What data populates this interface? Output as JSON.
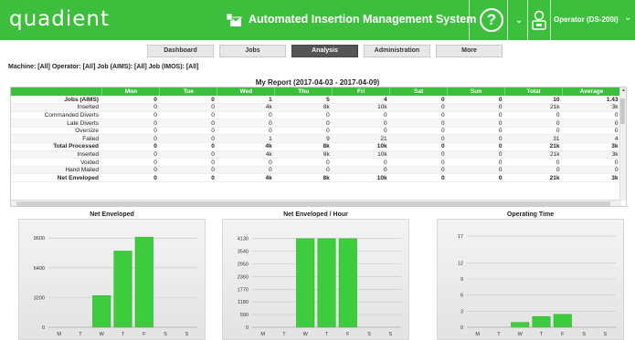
{
  "header": {
    "logo": "quadient",
    "title": "Automated Insertion Management System",
    "help": "?",
    "user": "Operator (DS-200i)"
  },
  "nav": [
    "Dashboard",
    "Jobs",
    "Analysis",
    "Administration",
    "More"
  ],
  "nav_active": "Analysis",
  "filters": "Machine: [All]   Operator: [All]   Job (AIMS): [All]   Job (IMOS): [All]",
  "report_title": "My Report (2017-04-03 - 2017-04-09)",
  "table": {
    "columns": [
      "",
      "Mon",
      "Tue",
      "Wed",
      "Thu",
      "Fri",
      "Sat",
      "Sun",
      "Total",
      "Average"
    ],
    "rows": [
      {
        "label": "Jobs (AIMS)",
        "bold": true,
        "cells": [
          "0",
          "0",
          "1",
          "5",
          "4",
          "0",
          "0",
          "10",
          "1.43"
        ]
      },
      {
        "label": "Inserted",
        "bold": false,
        "cells": [
          "0",
          "0",
          "4k",
          "8k",
          "10k",
          "0",
          "0",
          "21k",
          "3k"
        ]
      },
      {
        "label": "Commanded Diverts",
        "bold": false,
        "cells": [
          "0",
          "0",
          "0",
          "0",
          "0",
          "0",
          "0",
          "0",
          "0"
        ]
      },
      {
        "label": "Late Diverts",
        "bold": false,
        "cells": [
          "0",
          "0",
          "0",
          "0",
          "0",
          "0",
          "0",
          "0",
          "0"
        ]
      },
      {
        "label": "Oversize",
        "bold": false,
        "cells": [
          "0",
          "0",
          "0",
          "0",
          "0",
          "0",
          "0",
          "0",
          "0"
        ]
      },
      {
        "label": "Failed",
        "bold": false,
        "cells": [
          "0",
          "0",
          "1",
          "9",
          "21",
          "0",
          "0",
          "31",
          "4"
        ]
      },
      {
        "label": "Total Processed",
        "bold": true,
        "cells": [
          "0",
          "0",
          "4k",
          "8k",
          "10k",
          "0",
          "0",
          "21k",
          "3k"
        ]
      },
      {
        "label": "Inserted",
        "bold": false,
        "cells": [
          "0",
          "0",
          "4k",
          "8k",
          "10k",
          "0",
          "0",
          "21k",
          "3k"
        ]
      },
      {
        "label": "Voided",
        "bold": false,
        "cells": [
          "0",
          "0",
          "0",
          "0",
          "0",
          "0",
          "0",
          "0",
          "0"
        ]
      },
      {
        "label": "Hand Mailed",
        "bold": false,
        "cells": [
          "0",
          "0",
          "0",
          "0",
          "0",
          "0",
          "0",
          "0",
          "0"
        ]
      },
      {
        "label": "Net Enveloped",
        "bold": true,
        "cells": [
          "0",
          "0",
          "4k",
          "8k",
          "10k",
          "0",
          "0",
          "21k",
          "3k"
        ]
      }
    ]
  },
  "colors": {
    "brand": "#3dbf3d",
    "bar": "#3dcc3d",
    "nav_active": "#555555"
  },
  "chart_data": [
    {
      "type": "bar",
      "title": "Net Enveloped",
      "categories": [
        "M",
        "T",
        "W",
        "T",
        "F",
        "S",
        "S"
      ],
      "values": [
        0,
        0,
        3400,
        8200,
        9700,
        0,
        0
      ],
      "yticks": [
        0,
        3200,
        6400,
        9600
      ],
      "ylim": [
        0,
        10400
      ],
      "grid": true
    },
    {
      "type": "bar",
      "title": "Net Enveloped / Hour",
      "categories": [
        "M",
        "T",
        "W",
        "T",
        "F",
        "S",
        "S"
      ],
      "values": [
        0,
        0,
        4130,
        4130,
        4130,
        0,
        0
      ],
      "yticks": [
        0,
        590,
        1180,
        1770,
        2360,
        2950,
        3540,
        4130
      ],
      "ylim": [
        0,
        4500
      ],
      "grid": true
    },
    {
      "type": "bar",
      "title": "Operating Time",
      "categories": [
        "M",
        "T",
        "W",
        "T",
        "F",
        "S",
        "S"
      ],
      "values": [
        0,
        0,
        0.9,
        2.0,
        2.4,
        0,
        0
      ],
      "yticks": [
        0,
        3,
        6,
        9,
        12,
        17
      ],
      "ylim": [
        0,
        18
      ],
      "grid": true
    }
  ]
}
